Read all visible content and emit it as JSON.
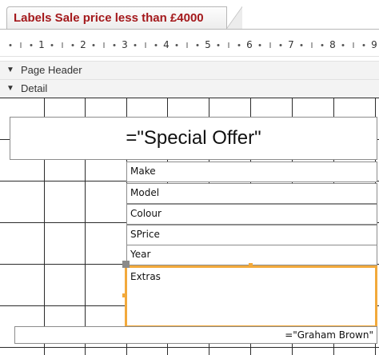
{
  "tab": {
    "title": "Labels Sale price less than £4000"
  },
  "ruler": {
    "labels": [
      "1",
      "2",
      "3",
      "4",
      "5",
      "6",
      "7",
      "8",
      "9"
    ]
  },
  "sections": {
    "page_header": "Page Header",
    "detail": "Detail"
  },
  "controls": {
    "title": "=\"Special Offer\"",
    "fields": [
      "Make",
      "Model",
      "Colour",
      "SPrice",
      "Year"
    ],
    "extras": "Extras",
    "footer": "=\"Graham Brown\""
  },
  "icons": {
    "section_expander": "triangle-down-icon"
  }
}
